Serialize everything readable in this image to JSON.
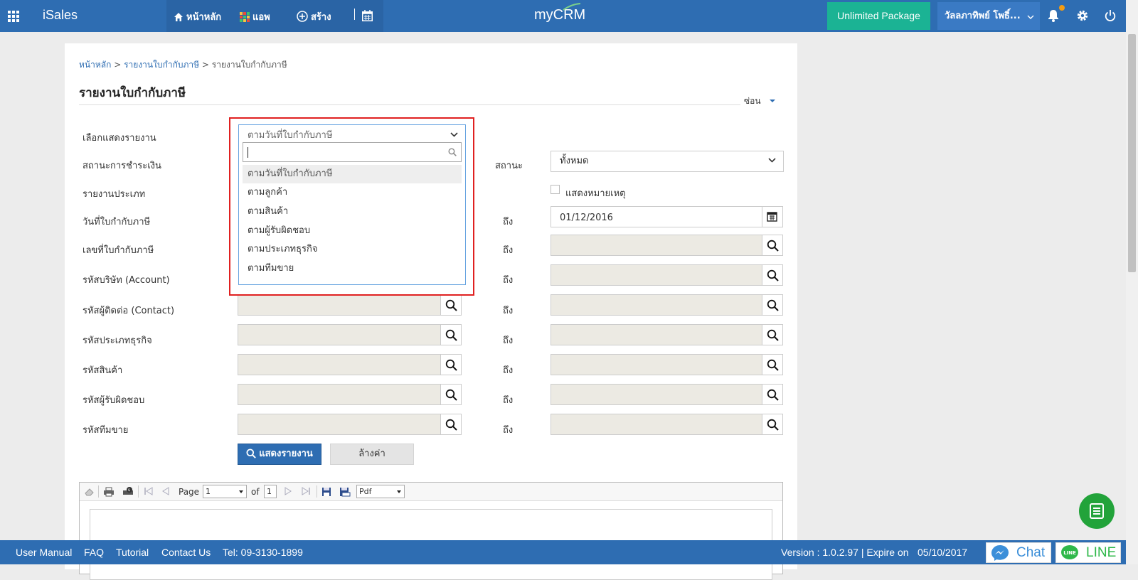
{
  "topbar": {
    "brand": "iSales",
    "nav_home": "หน้าหลัก",
    "nav_apps": "แอพ",
    "nav_create": "สร้าง",
    "logo": "myCRM",
    "package": "Unlimited Package",
    "user": "วัลลภาทิพย์ โพธิ์..."
  },
  "breadcrumb": {
    "home": "หน้าหลัก",
    "sep": ">",
    "parent": "รายงานใบกำกับภาษี",
    "current": "รายงานใบกำกับภาษี"
  },
  "page": {
    "title": "รายงานใบกำกับภาษี",
    "hide_toggle": "ซ่อน"
  },
  "form": {
    "report_view_label": "เลือกแสดงรายงาน",
    "report_view_value": "ตามวันที่ใบกำกับภาษี",
    "payment_status_label": "สถานะการชำระเงิน",
    "status_label": "สถานะ",
    "status_value": "ทั้งหมด",
    "report_type_label": "รายงานประเภท",
    "show_note_label": "แสดงหมายเหตุ",
    "invoice_date_label": "วันที่ใบกำกับภาษี",
    "invoice_no_label": "เลขที่ใบกำกับภาษี",
    "account_code_label": "รหัสบริษัท (Account)",
    "contact_code_label": "รหัสผู้ติดต่อ (Contact)",
    "business_type_label": "รหัสประเภทธุรกิจ",
    "product_code_label": "รหัสสินค้า",
    "owner_code_label": "รหัสผู้รับผิดชอบ",
    "sales_team_label": "รหัสทีมขาย",
    "to_label": "ถึง",
    "date_to_value": "01/12/2016",
    "show_report_button": "แสดงรายงาน",
    "reset_button": "ล้างค่า"
  },
  "dropdown": {
    "options": [
      "ตามวันที่ใบกำกับภาษี",
      "ตามลูกค้า",
      "ตามสินค้า",
      "ตามผู้รับผิดชอบ",
      "ตามประเภทธุรกิจ",
      "ตามทีมขาย"
    ],
    "active_index": 0
  },
  "viewer": {
    "page_label": "Page",
    "page_value": "1",
    "of_label": "of",
    "total_pages": "1",
    "export_format": "Pdf"
  },
  "footer": {
    "user_manual": "User Manual",
    "faq": "FAQ",
    "tutorial": "Tutorial",
    "contact_us": "Contact Us",
    "tel": "Tel: 09-3130-1899",
    "version": "Version : 1.0.2.97 | Expire on",
    "expire_date": "05/10/2017",
    "chat": "Chat",
    "line": "LINE"
  },
  "colors": {
    "primary": "#2e6db2",
    "package": "#1bb394",
    "highlight": "#e02020",
    "fab": "#22a33a"
  },
  "icons": [
    "apps-grid-icon",
    "home-icon",
    "apps-icon",
    "plus-circle-icon",
    "calendar-icon",
    "bell-icon",
    "gear-icon",
    "power-icon",
    "search-icon",
    "chevron-down-icon",
    "messenger-icon",
    "line-icon",
    "document-icon"
  ]
}
